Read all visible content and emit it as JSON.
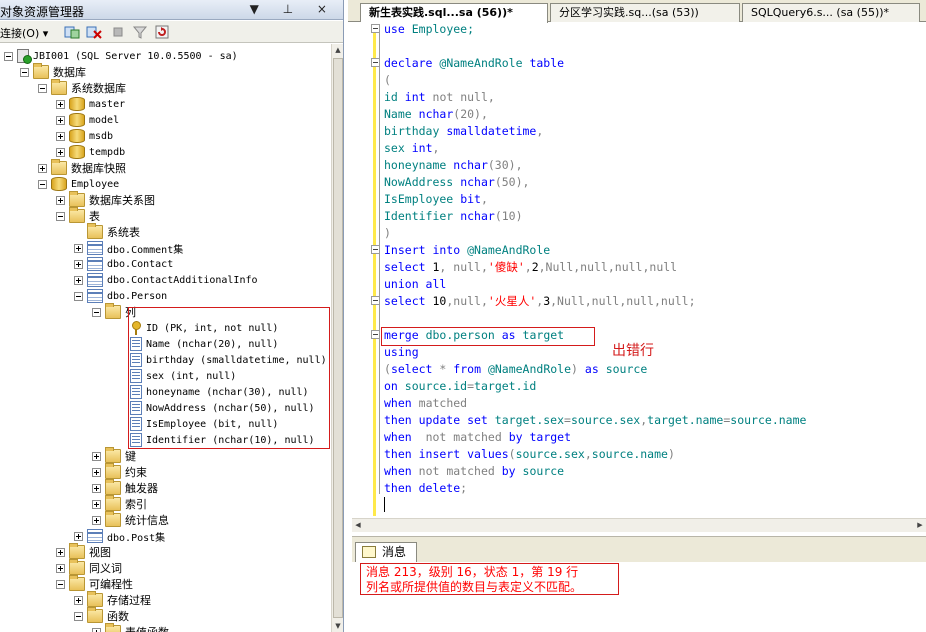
{
  "object_explorer": {
    "title": "对象资源管理器",
    "title_buttons": "▼ ⊥ ×",
    "connect_label": "连接(O)",
    "tree": {
      "server": "JBI001 (SQL Server 10.0.5500 - sa)",
      "databases": "数据库",
      "system_databases": "系统数据库",
      "sys_dbs": [
        "master",
        "model",
        "msdb",
        "tempdb"
      ],
      "snapshots": "数据库快照",
      "employee_db": "Employee",
      "diagrams": "数据库关系图",
      "tables": "表",
      "system_tables": "系统表",
      "tables_list": [
        "dbo.Comment集",
        "dbo.Contact",
        "dbo.ContactAdditionalInfo",
        "dbo.Person"
      ],
      "columns_folder": "列",
      "columns": [
        "ID (PK, int, not null)",
        "Name (nchar(20), null)",
        "birthday (smalldatetime, null)",
        "sex (int, null)",
        "honeyname (nchar(30), null)",
        "NowAddress (nchar(50), null)",
        "IsEmployee (bit, null)",
        "Identifier (nchar(10), null)"
      ],
      "person_folders": [
        "键",
        "约束",
        "触发器",
        "索引",
        "统计信息"
      ],
      "post_table": "dbo.Post集",
      "views": "视图",
      "synonyms": "同义词",
      "programmability": "可编程性",
      "stored_procedures": "存储过程",
      "functions": "函数",
      "table_valued_functions": "表值函数"
    }
  },
  "editor": {
    "tabs": [
      {
        "label": "新生表实践.sql...sa (56))*",
        "active": true
      },
      {
        "label": "分区学习实践.sq...(sa (53))",
        "active": false
      },
      {
        "label": "SQLQuery6.s... (sa (55))*",
        "active": false
      }
    ],
    "annotation": "出错行"
  },
  "messages": {
    "tab_label": "消息",
    "line1": "消息 213，级别 16，状态 1，第 19 行",
    "line2": "列名或所提供值的数目与表定义不匹配。"
  }
}
